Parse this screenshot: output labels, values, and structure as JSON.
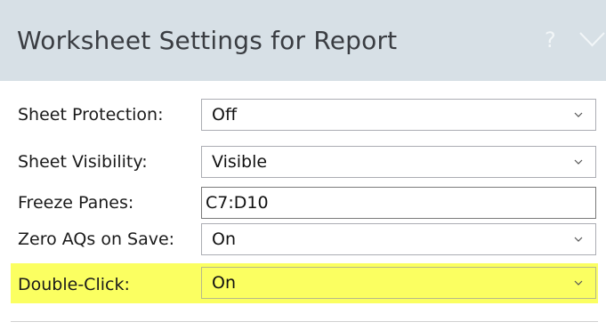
{
  "header": {
    "title": "Worksheet Settings for Report",
    "help_icon": "question-mark-icon",
    "collapse_icon": "chevron-down-icon"
  },
  "settings": [
    {
      "label": "Sheet Protection:",
      "type": "dropdown",
      "value": "Off"
    },
    {
      "label": "Sheet Visibility:",
      "type": "dropdown",
      "value": "Visible"
    },
    {
      "label": "Freeze Panes:",
      "type": "text",
      "value": "C7:D10"
    },
    {
      "label": "Zero AQs on Save:",
      "type": "dropdown",
      "value": "On"
    },
    {
      "label": "Double-Click:",
      "type": "dropdown",
      "value": "On",
      "highlighted": true
    }
  ],
  "colors": {
    "header_bg": "#d7e0e6",
    "highlight": "#fbff61"
  }
}
